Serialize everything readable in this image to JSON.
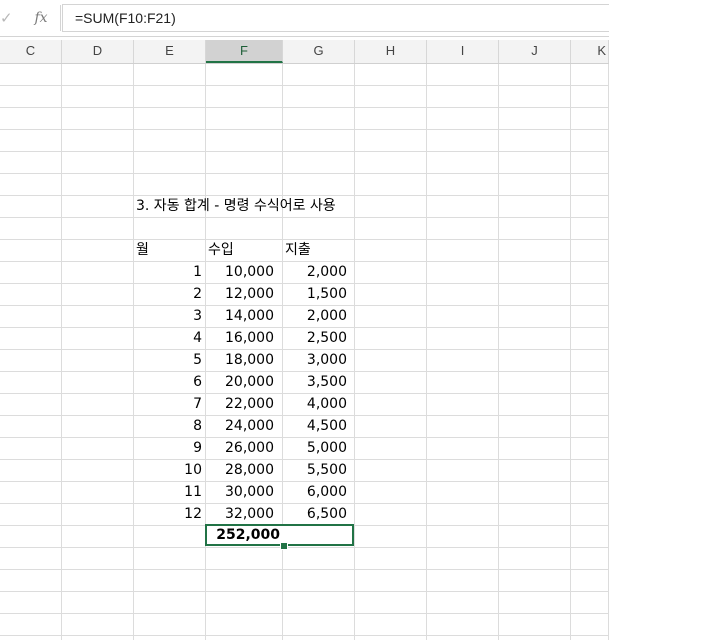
{
  "formula_bar": {
    "check_icon": "checkmark-icon",
    "fx_label": "fx",
    "formula": "=SUM(F10:F21)"
  },
  "columns": [
    "C",
    "D",
    "E",
    "F",
    "G",
    "H",
    "I",
    "J",
    "K"
  ],
  "selected_column": "F",
  "sheet": {
    "title": "3. 자동 합계 - 명령 수식어로 사용",
    "headers": {
      "month": "월",
      "income": "수입",
      "expense": "지출"
    },
    "rows": [
      {
        "month": "1",
        "income": "10,000",
        "expense": "2,000"
      },
      {
        "month": "2",
        "income": "12,000",
        "expense": "1,500"
      },
      {
        "month": "3",
        "income": "14,000",
        "expense": "2,000"
      },
      {
        "month": "4",
        "income": "16,000",
        "expense": "2,500"
      },
      {
        "month": "5",
        "income": "18,000",
        "expense": "3,000"
      },
      {
        "month": "6",
        "income": "20,000",
        "expense": "3,500"
      },
      {
        "month": "7",
        "income": "22,000",
        "expense": "4,000"
      },
      {
        "month": "8",
        "income": "24,000",
        "expense": "4,500"
      },
      {
        "month": "9",
        "income": "26,000",
        "expense": "5,000"
      },
      {
        "month": "10",
        "income": "28,000",
        "expense": "5,500"
      },
      {
        "month": "11",
        "income": "30,000",
        "expense": "6,000"
      },
      {
        "month": "12",
        "income": "32,000",
        "expense": "6,500"
      }
    ],
    "total": "252,000"
  },
  "colors": {
    "selection": "#217346",
    "header_bg": "#f3f3f3",
    "gridline": "#dcdcdc"
  }
}
